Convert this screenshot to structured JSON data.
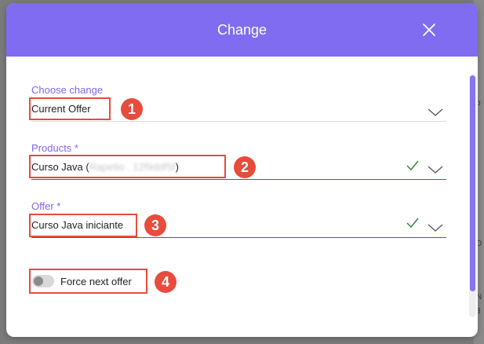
{
  "dialog": {
    "title": "Change",
    "close_icon": "close-icon"
  },
  "fields": {
    "choose_change": {
      "label": "Choose change",
      "value": "Current Offer"
    },
    "products": {
      "label": "Products *",
      "value_prefix": "Curso Java (",
      "value_blurred": "Rapetio . 12f9ddf5f",
      "value_suffix": ")"
    },
    "offer": {
      "label": "Offer *",
      "value": "Curso Java iniciante"
    },
    "force_next_offer": {
      "label": "Force next offer",
      "on": false
    }
  },
  "annotations": [
    "1",
    "2",
    "3",
    "4"
  ],
  "backdrop_fragments": [
    "o",
    "D",
    "N",
    "3"
  ],
  "colors": {
    "header": "#7f6cf0",
    "accent": "#8266ea",
    "valid": "#2e7d32",
    "annotation": "#e74c3c"
  }
}
